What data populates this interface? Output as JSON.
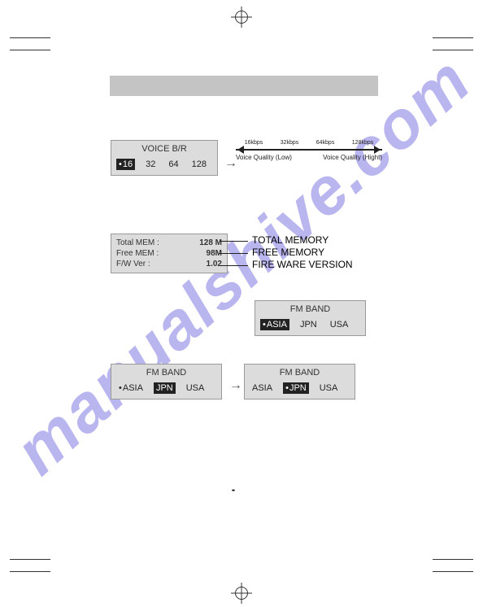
{
  "watermark": "manualshive.com",
  "voice_br": {
    "title": "VOICE  B/R",
    "options": [
      "16",
      "32",
      "64",
      "128"
    ],
    "selected": "16"
  },
  "quality": {
    "ticks": [
      "16kbps",
      "32kbps",
      "64kbps",
      "128kbps"
    ],
    "low": "Voice Quality (Low)",
    "high": "Voice Quality (Hight)"
  },
  "memory": {
    "total_label": "Total  MEM :",
    "total_value": "128 M",
    "free_label": "Free  MEM :",
    "free_value": "98M",
    "fw_label": "F/W  Ver :",
    "fw_value": "1.02"
  },
  "callouts": {
    "total": "TOTAL MEMORY",
    "free": "FREE MEMORY",
    "fw": "FIRE WARE VERSION"
  },
  "fm1": {
    "title": "FM BAND",
    "options": [
      "ASIA",
      "JPN",
      "USA"
    ],
    "selected": "ASIA"
  },
  "fm2a": {
    "title": "FM BAND",
    "options": [
      "ASIA",
      "JPN",
      "USA"
    ],
    "dotted": "ASIA",
    "highlighted": "JPN"
  },
  "fm2b": {
    "title": "FM BAND",
    "options": [
      "ASIA",
      "JPN",
      "USA"
    ],
    "selected": "JPN"
  },
  "page": "••"
}
